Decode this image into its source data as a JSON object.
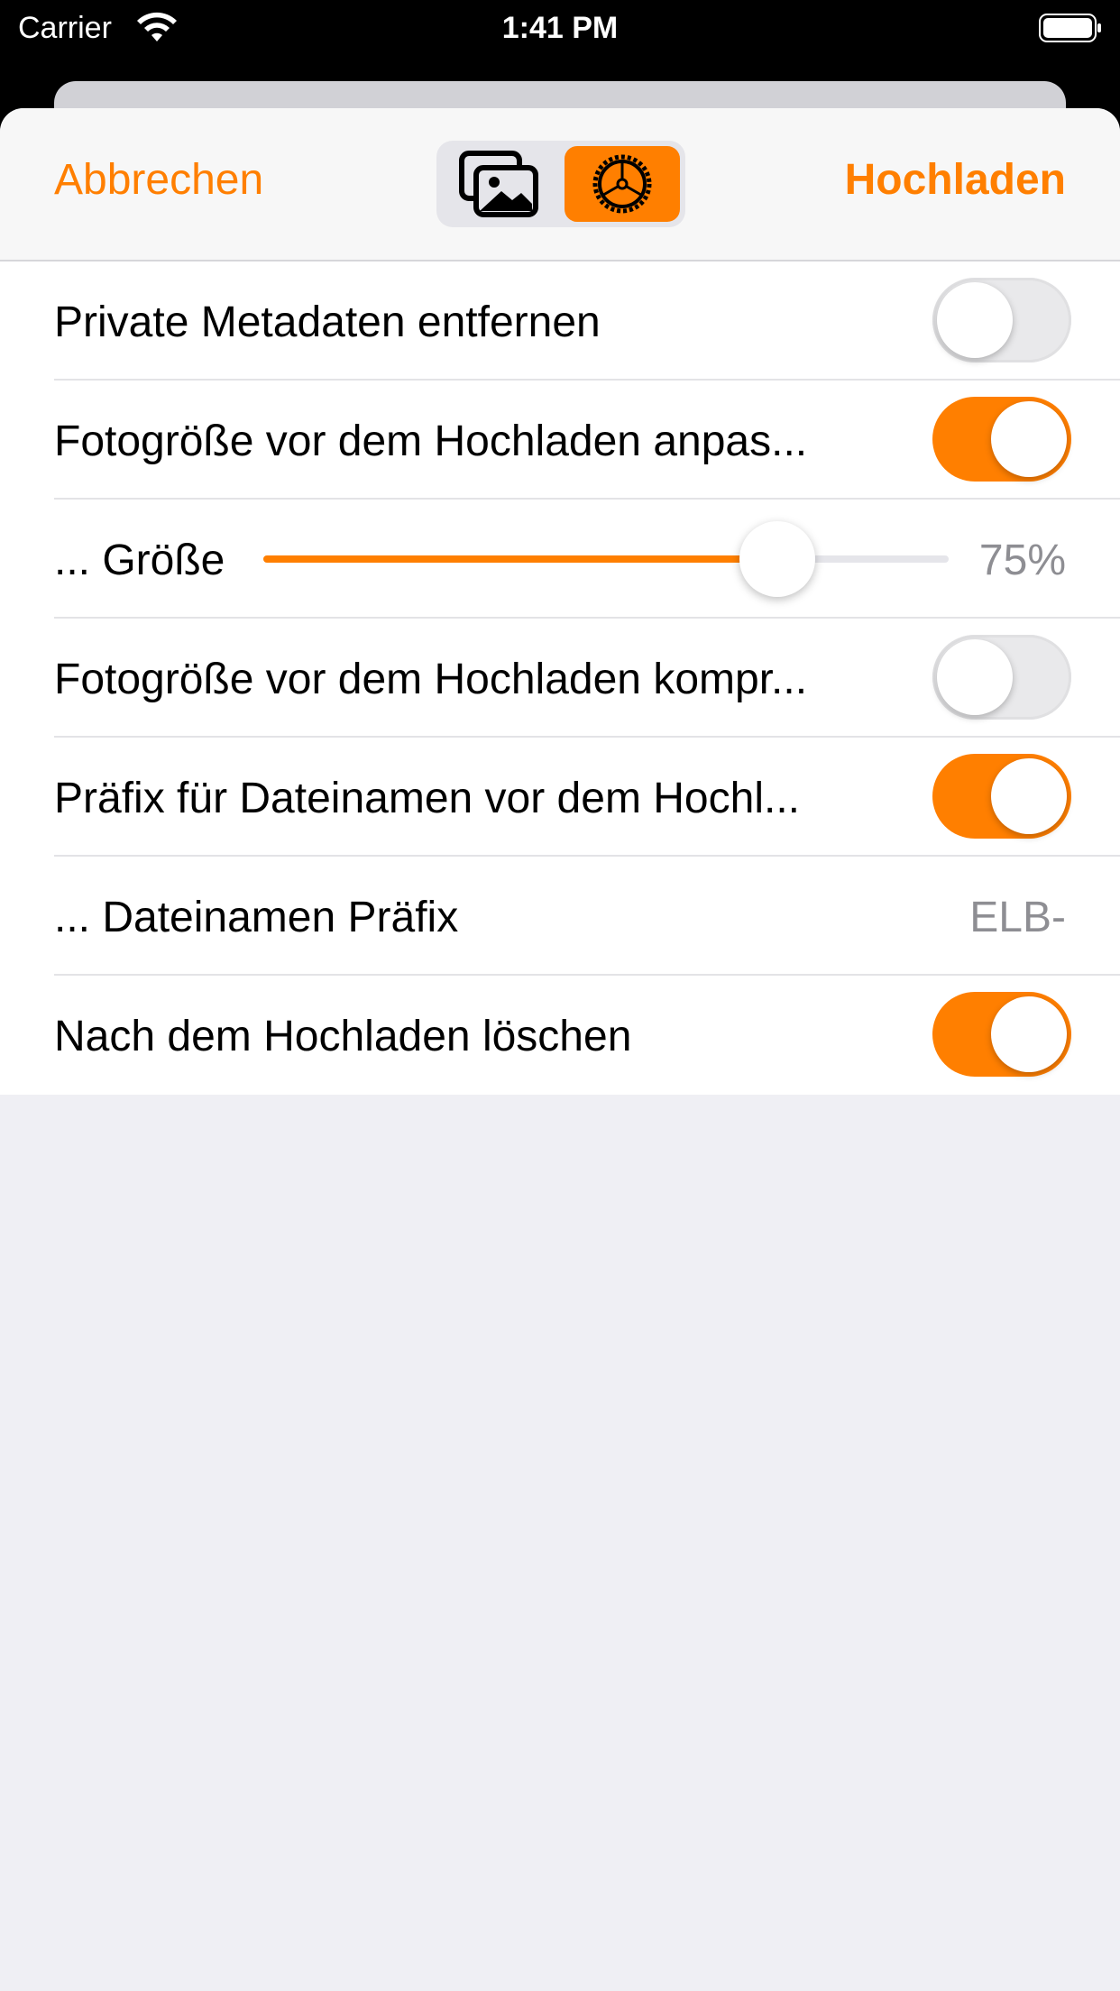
{
  "status": {
    "carrier": "Carrier",
    "time": "1:41 PM"
  },
  "navbar": {
    "cancel_label": "Abbrechen",
    "upload_label": "Hochladen",
    "segments": [
      {
        "icon": "photos-icon",
        "selected": false
      },
      {
        "icon": "gear-icon",
        "selected": true
      }
    ]
  },
  "settings": {
    "strip_metadata": {
      "label": "Private Metadaten entfernen",
      "on": false
    },
    "resize_before_upload": {
      "label": "Fotogröße vor dem Hochladen anpas...",
      "on": true
    },
    "size": {
      "label": "... Größe",
      "value_text": "75%",
      "value": 0.75
    },
    "compress_before_upload": {
      "label": "Fotogröße vor dem Hochladen kompr...",
      "on": false
    },
    "prefix_filenames": {
      "label": "Präfix für Dateinamen vor dem Hochl...",
      "on": true
    },
    "filename_prefix": {
      "label": "... Dateinamen Präfix",
      "value": "ELB-"
    },
    "delete_after_upload": {
      "label": "Nach dem Hochladen löschen",
      "on": true
    }
  },
  "colors": {
    "accent": "#ff7f00",
    "secondary_text": "#8e8e93",
    "background": "#efeff4"
  }
}
